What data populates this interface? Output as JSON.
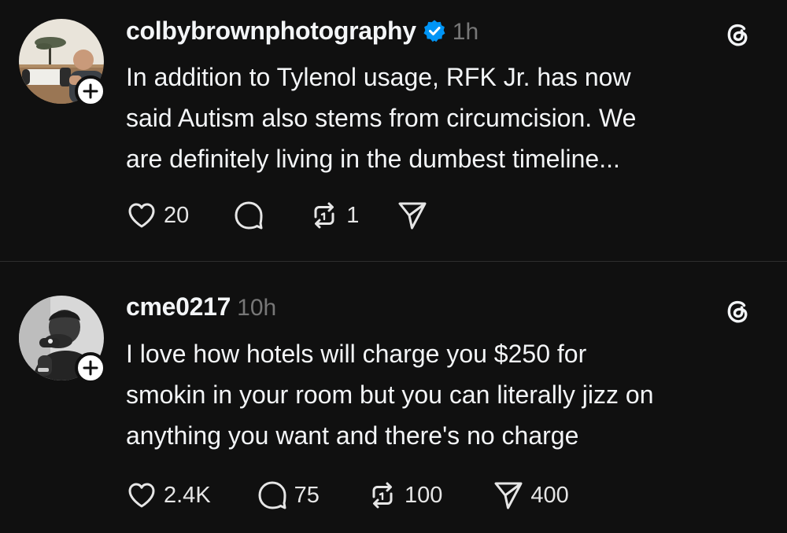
{
  "posts": [
    {
      "username": "colbybrownphotography",
      "verified": true,
      "timestamp": "1h",
      "text": "In addition to Tylenol usage, RFK Jr. has now\nsaid Autism also stems from circumcision. We\nare definitely living in the dumbest timeline...",
      "likes": "20",
      "replies": "",
      "reposts": "1",
      "shares": ""
    },
    {
      "username": "cme0217",
      "verified": false,
      "timestamp": "10h",
      "text": "I love how hotels will charge you $250 for\nsmokin in your room but you can literally jizz on\nanything you want and there's no charge",
      "likes": "2.4K",
      "replies": "75",
      "reposts": "100",
      "shares": "400"
    }
  ],
  "icons": {
    "like": "heart-icon",
    "reply": "speech-bubble-icon",
    "repost": "repost-icon",
    "share": "paper-plane-icon",
    "threads": "threads-logo-icon",
    "verified": "verified-badge-icon",
    "follow": "plus-icon"
  },
  "colors": {
    "background": "#101010",
    "text": "#f3f5f7",
    "secondary": "#777777",
    "verified": "#0095f6",
    "divider": "#2e2e2e"
  }
}
